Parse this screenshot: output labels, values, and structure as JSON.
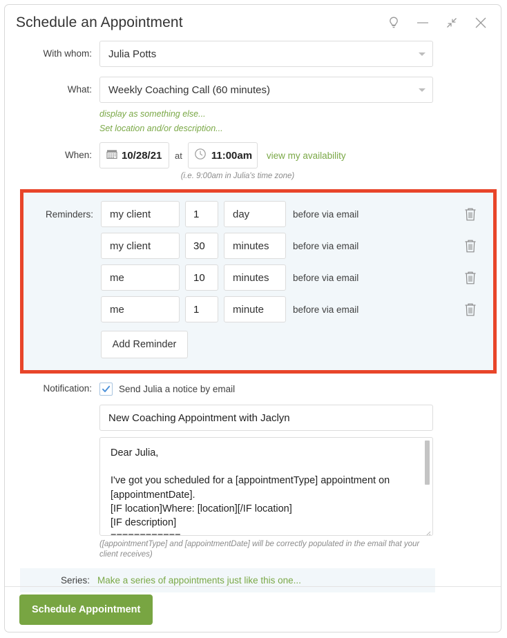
{
  "window": {
    "title": "Schedule an Appointment",
    "controls": [
      {
        "name": "lightbulb-icon",
        "label": "Tips"
      },
      {
        "name": "minimize-icon",
        "label": "Minimize"
      },
      {
        "name": "collapse-icon",
        "label": "Collapse"
      },
      {
        "name": "close-icon",
        "label": "Close"
      }
    ]
  },
  "form": {
    "with_whom": {
      "label": "With whom:",
      "value": "Julia Potts"
    },
    "what": {
      "label": "What:",
      "value": "Weekly Coaching Call (60 minutes)",
      "link_display_as": "display as something else...",
      "link_location": "Set location and/or description..."
    },
    "when": {
      "label": "When:",
      "date": "10/28/21",
      "at": "at",
      "time": "11:00am",
      "availability_link": "view my availability",
      "timezone_hint": "(i.e. 9:00am in Julia's time zone)"
    },
    "reminders": {
      "label": "Reminders:",
      "add_button": "Add Reminder",
      "rows": [
        {
          "who": "my client",
          "amount": "1",
          "unit": "day",
          "suffix": "before via email"
        },
        {
          "who": "my client",
          "amount": "30",
          "unit": "minutes",
          "suffix": "before via email"
        },
        {
          "who": "me",
          "amount": "10",
          "unit": "minutes",
          "suffix": "before via email"
        },
        {
          "who": "me",
          "amount": "1",
          "unit": "minute",
          "suffix": "before via email"
        }
      ]
    },
    "notification": {
      "label": "Notification:",
      "checkbox_label": "Send Julia a notice by email",
      "checked": true,
      "subject": "New Coaching Appointment with Jaclyn",
      "body": "Dear Julia,\n\nI've got you scheduled for a [appointmentType] appointment on [appointmentDate].\n[IF location]Where: [location][/IF location]\n[IF description]\n============",
      "hint": "([appointmentType] and [appointmentDate] will be correctly populated in the email that your client receives)"
    },
    "series": {
      "label": "Series:",
      "link": "Make a series of appointments just like this one..."
    }
  },
  "footer": {
    "submit_label": "Schedule Appointment"
  },
  "colors": {
    "accent_green": "#78a542",
    "link_green": "#7aa846",
    "highlight_red": "#e8452a",
    "panel_bg": "#f2f7fa",
    "checkbox_blue": "#4a90d9"
  }
}
